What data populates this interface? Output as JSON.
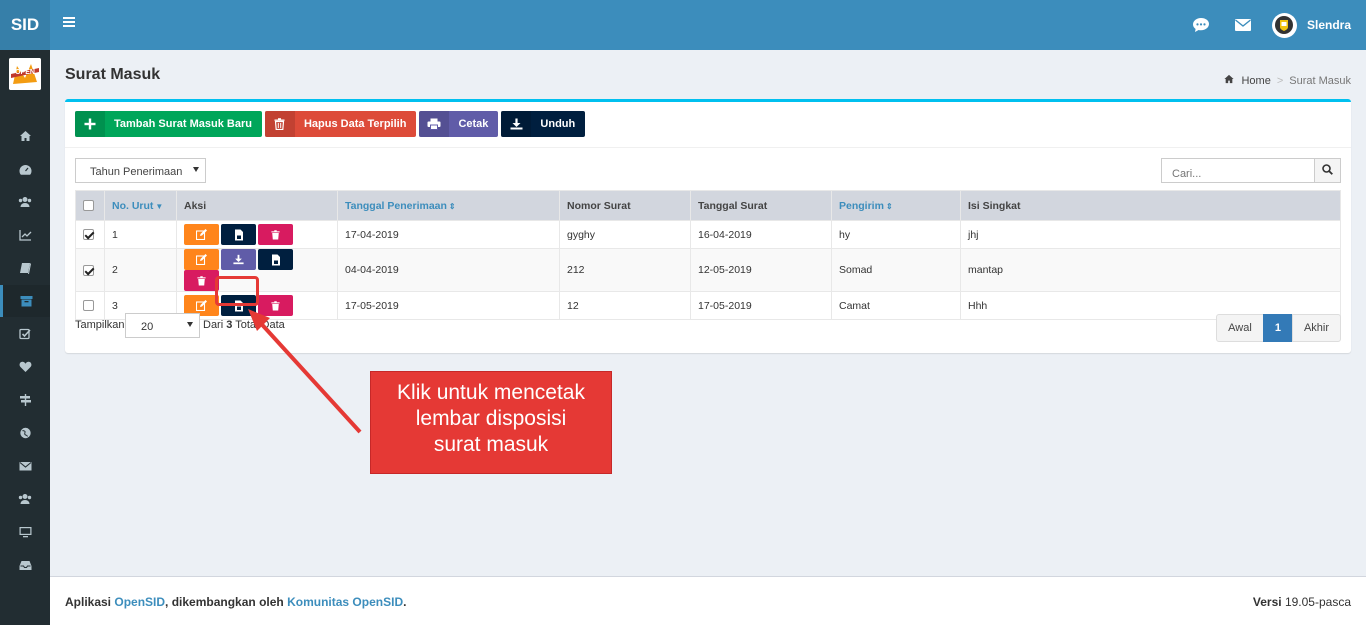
{
  "app": {
    "logo_text": "SID",
    "user_name": "Slendra"
  },
  "sidebar": {
    "items": [
      {
        "icon": "home-icon"
      },
      {
        "icon": "dashboard-icon"
      },
      {
        "icon": "users-icon"
      },
      {
        "icon": "chart-icon"
      },
      {
        "icon": "book-icon"
      },
      {
        "icon": "archive-icon"
      },
      {
        "icon": "check-square-icon"
      },
      {
        "icon": "heart-icon"
      },
      {
        "icon": "signpost-icon"
      },
      {
        "icon": "globe-icon"
      },
      {
        "icon": "envelope-icon"
      },
      {
        "icon": "group-icon"
      },
      {
        "icon": "desktop-icon"
      },
      {
        "icon": "inbox-icon"
      }
    ],
    "active_index": 5
  },
  "page": {
    "title": "Surat Masuk"
  },
  "breadcrumb": {
    "home": "Home",
    "current": "Surat Masuk"
  },
  "toolbar": {
    "add_label": "Tambah Surat Masuk Baru",
    "delete_label": "Hapus Data Terpilih",
    "print_label": "Cetak",
    "download_label": "Unduh"
  },
  "filters": {
    "year_label": "Tahun Penerimaan",
    "search_placeholder": "Cari..."
  },
  "table": {
    "headers": {
      "no": "No. Urut",
      "aksi": "Aksi",
      "tanggal_penerimaan": "Tanggal Penerimaan",
      "nomor_surat": "Nomor Surat",
      "tanggal_surat": "Tanggal Surat",
      "pengirim": "Pengirim",
      "isi": "Isi Singkat"
    },
    "rows": [
      {
        "checked": true,
        "no": "1",
        "tanggal_penerimaan": "17-04-2019",
        "nomor_surat": "gyghy",
        "tanggal_surat": "16-04-2019",
        "pengirim": "hy",
        "isi": "jhj"
      },
      {
        "checked": true,
        "no": "2",
        "tanggal_penerimaan": "04-04-2019",
        "nomor_surat": "212",
        "tanggal_surat": "12-05-2019",
        "pengirim": "Somad",
        "isi": "mantap"
      },
      {
        "checked": false,
        "no": "3",
        "tanggal_penerimaan": "17-05-2019",
        "nomor_surat": "12",
        "tanggal_surat": "17-05-2019",
        "pengirim": "Camat",
        "isi": "Hhh"
      }
    ]
  },
  "pagination": {
    "show_label": "Tampilkan",
    "page_size": "20",
    "total_prefix": "Dari",
    "total_count": "3",
    "total_suffix": "Total Data",
    "first_label": "Awal",
    "current_page": "1",
    "last_label": "Akhir"
  },
  "annotation": {
    "text": "Klik untuk mencetak\nlembar disposisi\nsurat masuk",
    "color": "#e53935"
  },
  "footer": {
    "prefix": "Aplikasi",
    "app_link": "OpenSID",
    "middle": ", dikembangkan oleh",
    "community_link": "Komunitas OpenSID",
    "suffix": ".",
    "version_label": "Versi",
    "version_value": "19.05-pasca"
  }
}
